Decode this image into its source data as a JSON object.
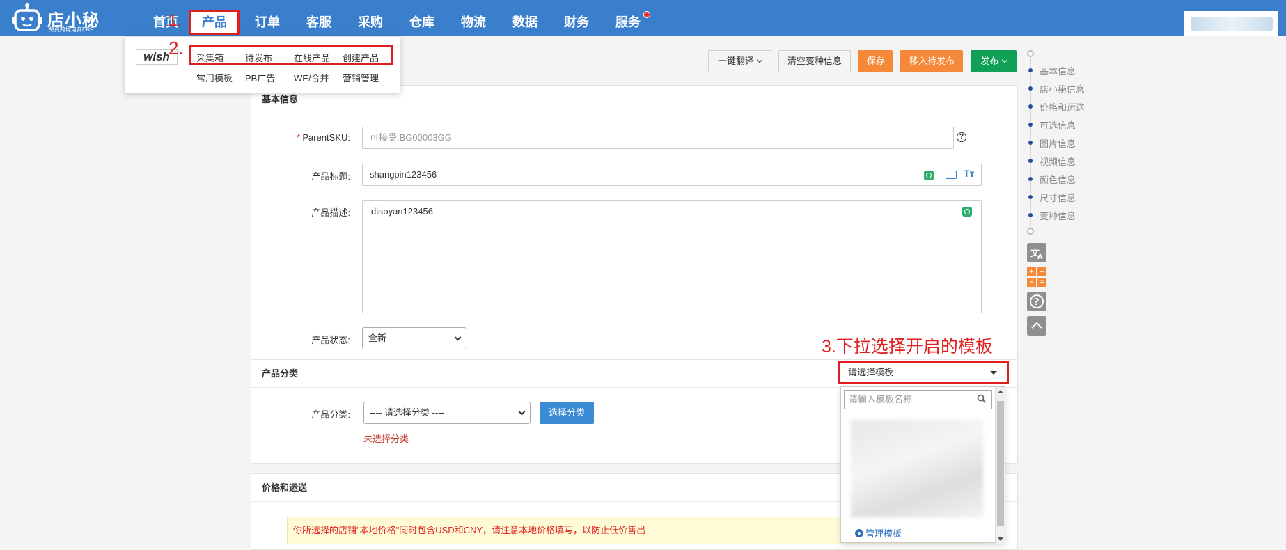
{
  "app": {
    "brand": "店小秘",
    "tagline": "免费跨境电商ERP"
  },
  "nav": [
    "首页",
    "产品",
    "订单",
    "客服",
    "采购",
    "仓库",
    "物流",
    "数据",
    "财务",
    "服务"
  ],
  "annotations": {
    "step1": "1.",
    "step2": "2.",
    "step3": "3.下拉选择开启的模板"
  },
  "menu": {
    "platform": "wish",
    "row1": [
      "采集箱",
      "待发布",
      "在线产品",
      "创建产品"
    ],
    "row2": [
      "常用模板",
      "PB广告",
      "WE/合并",
      "营销管理"
    ]
  },
  "toolbar": {
    "translate": "一键翻译",
    "clear_variants": "清空变种信息",
    "save": "保存",
    "move_pending": "移入待发布",
    "publish": "发布"
  },
  "basic": {
    "title": "基本信息",
    "parent_sku_label": "ParentSKU:",
    "parent_sku_placeholder": "可接受:BG00003GG",
    "product_title_label": "产品标题:",
    "product_title_value": "shangpin123456",
    "product_desc_label": "产品描述:",
    "product_desc_value": "diaoyan123456",
    "status_label": "产品状态:",
    "status_value": "全新"
  },
  "category": {
    "title": "产品分类",
    "label": "产品分类:",
    "select_value": "---- 请选择分类 ----",
    "choose_button": "选择分类",
    "error": "未选择分类"
  },
  "template": {
    "select_value": "请选择模板",
    "search_placeholder": "请输入模板名称",
    "manage": "管理模板"
  },
  "pricing": {
    "title": "价格和运送",
    "warning": "你所选择的店铺\"本地价格\"同时包含USD和CNY，请注意本地价格填写，以防止低价售出"
  },
  "anchors": [
    "基本信息",
    "店小秘信息",
    "价格和运送",
    "可选信息",
    "图片信息",
    "视频信息",
    "颜色信息",
    "尺寸信息",
    "变种信息"
  ],
  "colors": {
    "nav_bg": "#3a7fcb",
    "accent_orange": "#f6883a",
    "accent_green": "#11a156",
    "highlight_red": "#e02020"
  }
}
